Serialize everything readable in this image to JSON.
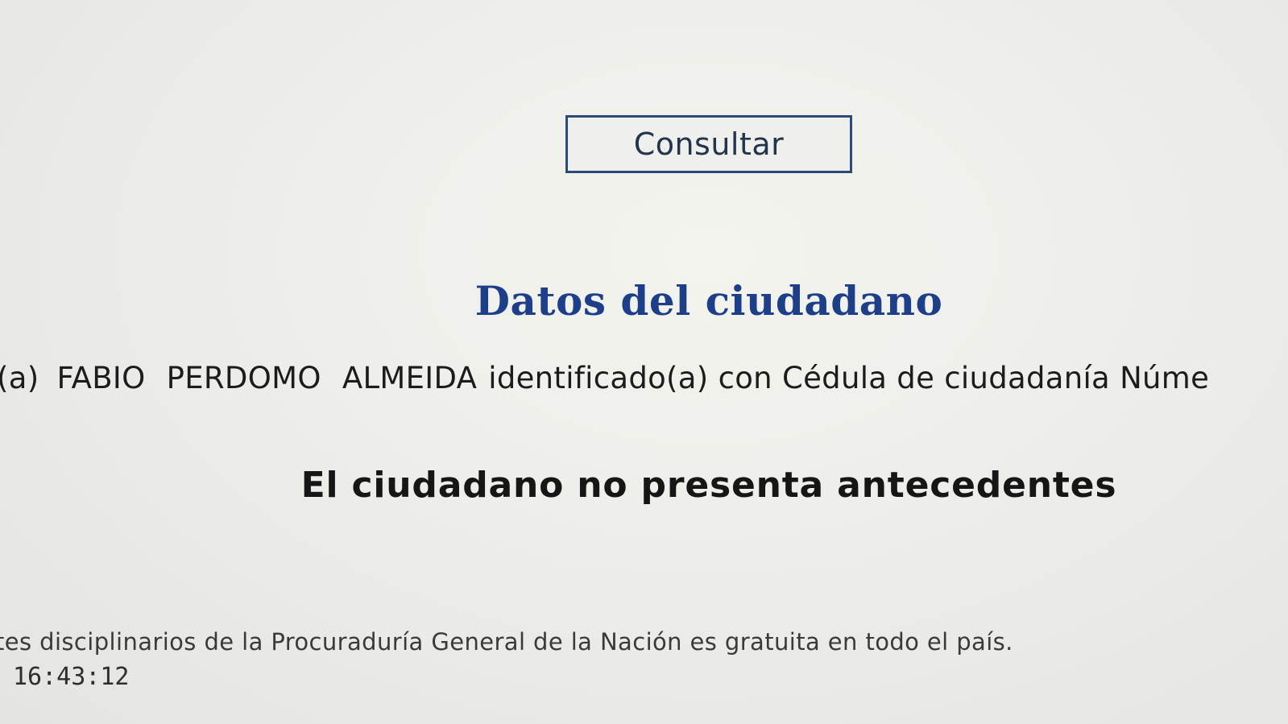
{
  "form": {
    "consult_button_label": "Consultar"
  },
  "citizen": {
    "section_title": "Datos del ciudadano",
    "prefix": "(a)",
    "full_name": "FABIO  PERDOMO ALMEIDA",
    "identification_text": "identificado(a) con Cédula de ciudadanía Núme"
  },
  "result": {
    "status_message": "El ciudadano no presenta antecedentes"
  },
  "footer": {
    "note": "tes disciplinarios de la Procuraduría General de la Nación es gratuita en todo el país.",
    "time": "16:43:12"
  },
  "colors": {
    "title_blue": "#1d3f8a",
    "button_border": "#2b4a7c",
    "background": "#ededea"
  }
}
